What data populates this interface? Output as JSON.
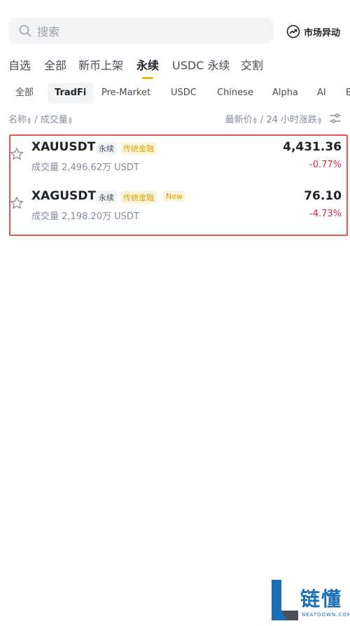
{
  "search": {
    "placeholder": "搜索"
  },
  "market_button": {
    "label": "市场异动"
  },
  "tabs": [
    {
      "label": "自选"
    },
    {
      "label": "全部"
    },
    {
      "label": "新币上架"
    },
    {
      "label": "永续",
      "active": true
    },
    {
      "label": "USDC 永续"
    },
    {
      "label": "交割"
    }
  ],
  "subtabs": [
    {
      "label": "全部"
    },
    {
      "label": "TradFi",
      "active": true
    },
    {
      "label": "Pre-Market"
    },
    {
      "label": "USDC"
    },
    {
      "label": "Chinese"
    },
    {
      "label": "Alpha"
    },
    {
      "label": "AI"
    },
    {
      "label": "B"
    }
  ],
  "sort": {
    "name": "名称",
    "volume": "成交量",
    "last_price": "最新价",
    "change_24h": "24 小时涨跌",
    "separator": "/"
  },
  "rows": [
    {
      "symbol": "XAUUSDT",
      "type_tag": "永续",
      "category_tag": "传统金融",
      "volume": "成交量 2,496.62万 USDT",
      "price": "4,431.36",
      "change": "-0.77%"
    },
    {
      "symbol": "XAGUSDT",
      "type_tag": "永续",
      "category_tag": "传统金融",
      "new_tag": "New",
      "volume": "成交量 2,198.20万 USDT",
      "price": "76.10",
      "change": "-4.73%"
    }
  ],
  "watermark": {
    "title": "链懂",
    "subtitle": "NEATDOWN.COM"
  },
  "colors": {
    "accent": "#f0b90b",
    "down": "#e0294a",
    "highlight": "#e05656",
    "brand_blue": "#1b6fb3"
  }
}
